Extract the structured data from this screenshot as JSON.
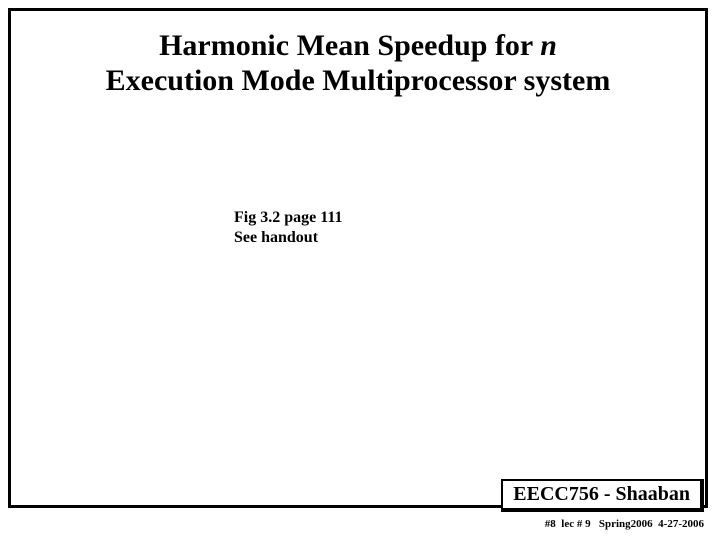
{
  "title": {
    "line1_prefix": "Harmonic Mean Speedup for ",
    "line1_italic": "n",
    "line2": "Execution Mode Multiprocessor system"
  },
  "figref": {
    "line1": "Fig 3.2 page 111",
    "line2": "See handout"
  },
  "footer": {
    "course": "EECC756 - Shaaban",
    "sub": "#8  lec # 9   Spring2006  4-27-2006"
  }
}
